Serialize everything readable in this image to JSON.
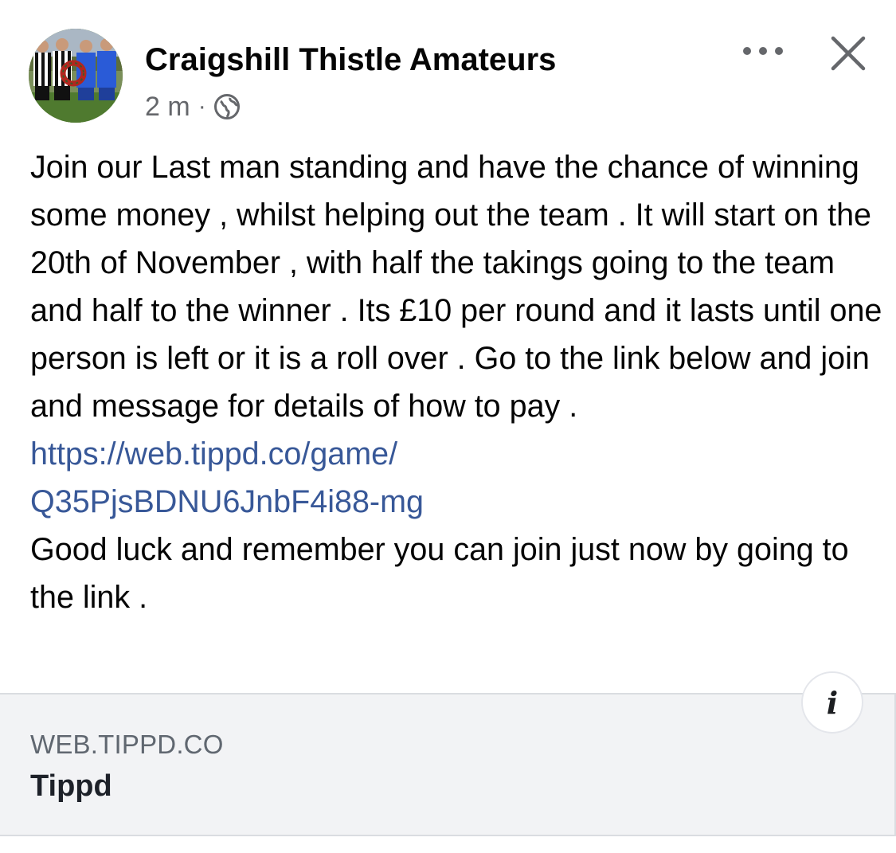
{
  "post": {
    "author": "Craigshill Thistle Amateurs",
    "timestamp": "2 m",
    "separator": "·",
    "audience_icon": "globe-icon",
    "text_paragraph_1": "Join our Last man standing and have the chance of winning some money , whilst helping out the team . It will start on the 20th of November , with half the takings going to the team and half to the winner . Its £10 per round and it lasts until one person is left or it is a roll over . Go to the link below and join and message for details of how to pay .",
    "link_line_1": "https://web.tippd.co/game/",
    "link_line_2": "Q35PjsBDNU6JnbF4i88-mg",
    "text_paragraph_2": "Good luck and remember you can join just now by going to the link ."
  },
  "actions": {
    "more_icon": "more-horizontal-icon",
    "close_icon": "close-icon"
  },
  "link_preview": {
    "domain": "WEB.TIPPD.CO",
    "title": "Tippd",
    "info_label": "i"
  },
  "colors": {
    "link": "#385898",
    "secondary_text": "#65676b",
    "card_background": "#f2f3f5"
  }
}
